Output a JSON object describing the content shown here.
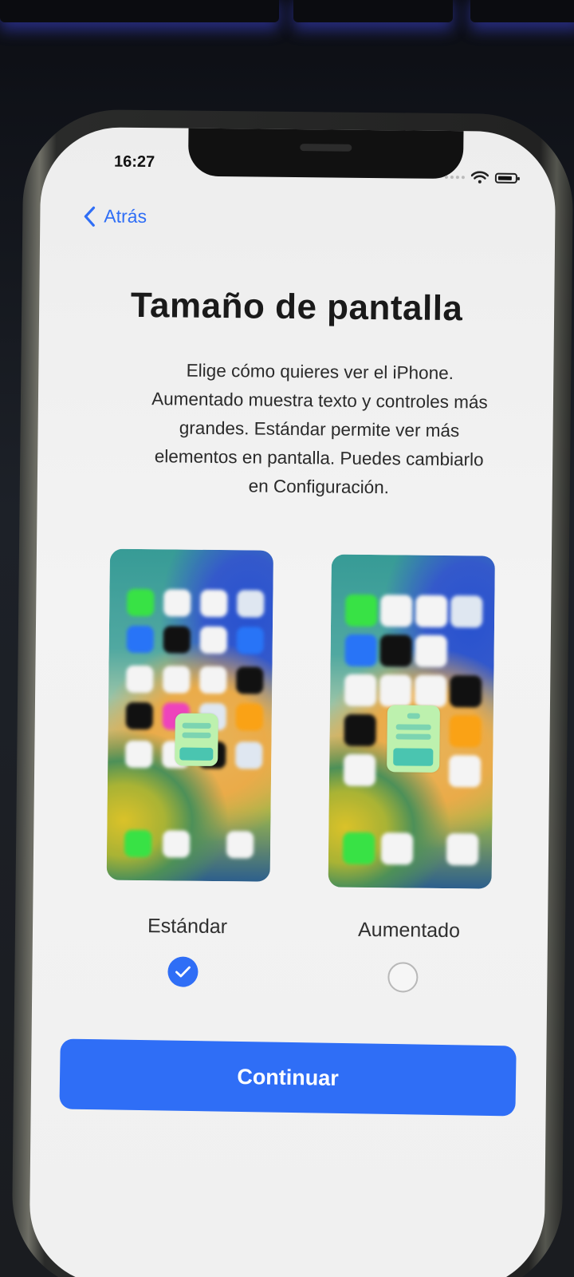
{
  "status_bar": {
    "time": "16:27"
  },
  "nav": {
    "back_label": "Atrás"
  },
  "title": "Tamaño de pantalla",
  "description_lines": [
    "Elige cómo quieres ver el iPhone.",
    "Aumentado muestra texto y controles más",
    "grandes. Estándar permite ver más",
    "elementos en pantalla. Puedes cambiarlo",
    "en Configuración."
  ],
  "options": [
    {
      "label": "Estándar",
      "selected": true
    },
    {
      "label": "Aumentado",
      "selected": false
    }
  ],
  "continue_label": "Continuar",
  "colors": {
    "accent": "#2f6ef6",
    "background": "#f0f0f0",
    "text": "#1a1a1a"
  }
}
